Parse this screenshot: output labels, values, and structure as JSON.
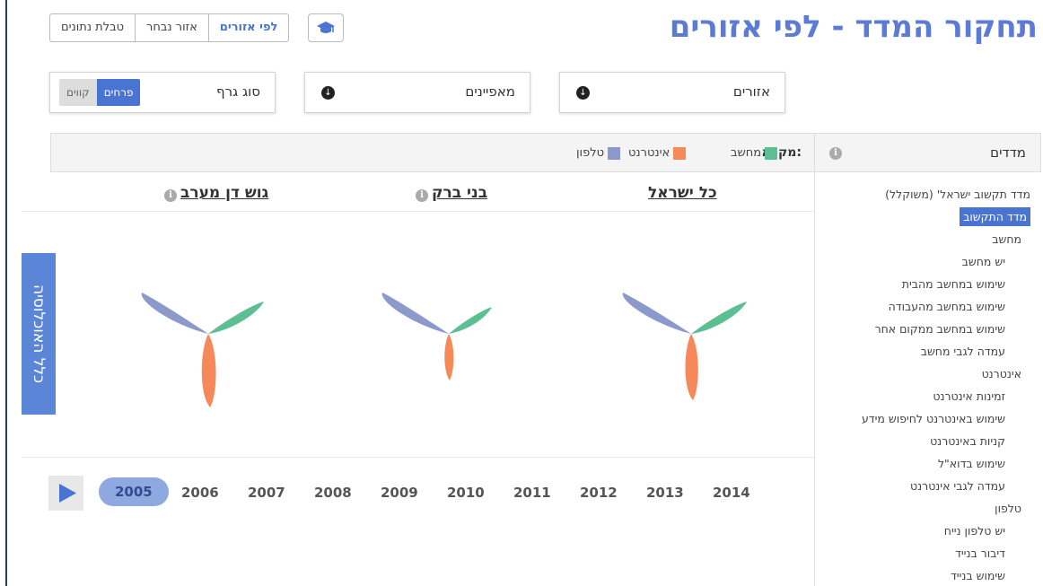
{
  "page": {
    "title": "תחקור המדד - לפי אזורים"
  },
  "view_tabs": [
    {
      "label": "לפי אזורים",
      "active": true
    },
    {
      "label": "אזור נבחר",
      "active": false
    },
    {
      "label": "טבלת נתונים",
      "active": false
    }
  ],
  "filters": {
    "regions_label": "אזורים",
    "characteristics_label": "מאפיינים",
    "chart_type_label": "סוג גרף",
    "chart_type_options": {
      "petals": "פרחים",
      "lines": "קווים"
    },
    "chart_type_selected": "פרחים"
  },
  "legend": {
    "title": "מקרא:",
    "items": [
      {
        "label": "מחשב",
        "color": "#5cbf94"
      },
      {
        "label": "אינטרנט",
        "color": "#f5895a"
      },
      {
        "label": "טלפון",
        "color": "#8b9acb"
      }
    ]
  },
  "sidebar": {
    "title": "מדדים",
    "items": [
      {
        "label": "מדד תקשוב ישראל' (משוקלל)",
        "level": 1,
        "selected": false
      },
      {
        "label": "מדד התקשוב",
        "level": 1,
        "selected": true
      },
      {
        "label": "מחשב",
        "level": 2,
        "selected": false
      },
      {
        "label": "יש מחשב",
        "level": 3,
        "selected": false
      },
      {
        "label": "שימוש במחשב מהבית",
        "level": 3,
        "selected": false
      },
      {
        "label": "שימוש במחשב מהעבודה",
        "level": 3,
        "selected": false
      },
      {
        "label": "שימוש במחשב ממקום אחר",
        "level": 3,
        "selected": false
      },
      {
        "label": "עמדה לגבי מחשב",
        "level": 3,
        "selected": false
      },
      {
        "label": "אינטרנט",
        "level": 2,
        "selected": false
      },
      {
        "label": "זמינות אינטרנט",
        "level": 3,
        "selected": false
      },
      {
        "label": "שימוש באינטרנט לחיפוש מידע",
        "level": 3,
        "selected": false
      },
      {
        "label": "קניות באינטרנט",
        "level": 3,
        "selected": false
      },
      {
        "label": "שימוש בדוא\"ל",
        "level": 3,
        "selected": false
      },
      {
        "label": "עמדה לגבי אינטרנט",
        "level": 3,
        "selected": false
      },
      {
        "label": "טלפון",
        "level": 2,
        "selected": false
      },
      {
        "label": "יש טלפון נייח",
        "level": 3,
        "selected": false
      },
      {
        "label": "דיבור בנייד",
        "level": 3,
        "selected": false
      },
      {
        "label": "שימוש בנייד",
        "level": 3,
        "selected": false
      }
    ]
  },
  "regions": [
    {
      "name": "כל ישראל",
      "info": false
    },
    {
      "name": "בני ברק",
      "info": true
    },
    {
      "name": "גוש דן מערב",
      "info": true
    }
  ],
  "population_label": "כלל האוכלוסיה",
  "timeline": {
    "years": [
      "2014",
      "2013",
      "2012",
      "2011",
      "2010",
      "2009",
      "2008",
      "2007",
      "2006",
      "2005"
    ],
    "selected": "2005"
  },
  "colors": {
    "accent": "#4a74d1",
    "computer": "#5cbf94",
    "internet": "#f5895a",
    "phone": "#8b9acb",
    "title": "#5b7bd5"
  },
  "icons": {
    "hat_button": "graduation-cap-icon",
    "download": "download-circle-icon",
    "info": "info-icon",
    "play": "play-icon"
  }
}
